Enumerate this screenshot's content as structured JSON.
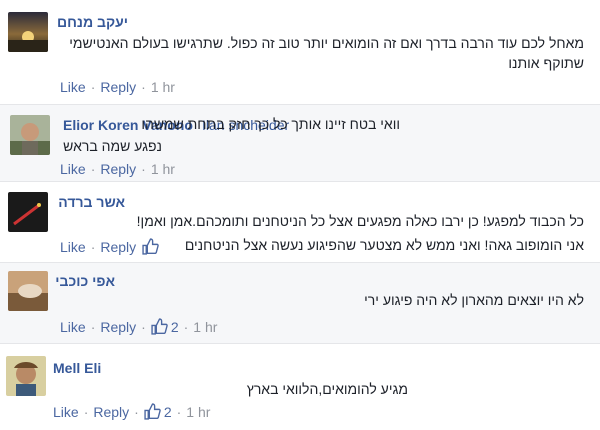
{
  "comments": [
    {
      "author": "יעקב מנחם",
      "lines": [
        "מאחל לכם עוד הרבה בדרך ואם זה הומואים יותר טוב זה כפול. שתרגישו בעולם האנטישמי",
        "שתוקף אותנו"
      ],
      "like_label": "Like",
      "reply_label": "Reply",
      "time": "1 hr"
    },
    {
      "author": "Elior Koren Vanono",
      "tagged": "Ilan sncheider",
      "lines": [
        "וואי בטח זיינו אותך כל כך חזק בתחת שמשהו",
        "נפגע שמה בראש"
      ],
      "like_label": "Like",
      "reply_label": "Reply",
      "time": "1 hr"
    },
    {
      "author": "אשר ברדה",
      "lines": [
        "כל הכבוד למפגע! כן ירבו כאלה מפגעים אצל כל הניטחנים ותומכהם.אמן ואמן!",
        "אני הומופוב גאה! ואני ממש לא מצטער שהפיגוע נעשה אצל הניטחנים"
      ],
      "like_label": "Like",
      "reply_label": "Reply",
      "time": ""
    },
    {
      "author": "אפי כוכבי",
      "lines": [
        "לא היו יוצאים מהארון לא היה פיגוע ירי"
      ],
      "like_label": "Like",
      "reply_label": "Reply",
      "likes": "2",
      "time": "1 hr"
    },
    {
      "author": "Mell Eli",
      "lines": [
        "מגיע להומואים,הלוואי בארץ"
      ],
      "like_label": "Like",
      "reply_label": "Reply",
      "likes": "2",
      "time": "1 hr"
    }
  ],
  "colors": {
    "link": "#365899",
    "meta": "#90949c",
    "action": "#4b67a1",
    "shaded_bg": "#f6f7f9"
  },
  "icons": {
    "like": "thumbs-up-icon"
  }
}
